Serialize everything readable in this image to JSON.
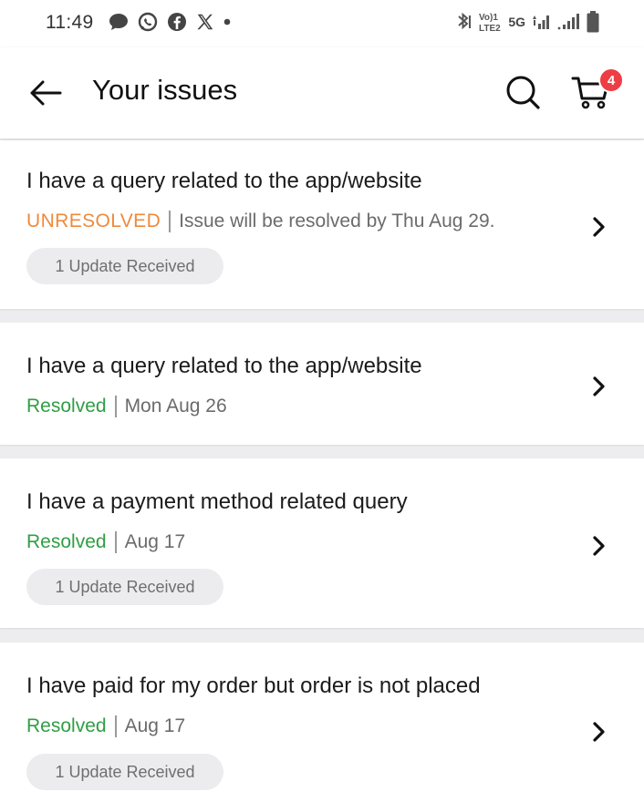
{
  "status_bar": {
    "time": "11:49",
    "notification_icons": [
      "message-icon",
      "whatsapp-icon",
      "facebook-icon",
      "x-icon",
      "dot-icon"
    ],
    "network_label": "5G",
    "volte_label": "VoLTE2",
    "system_icons": [
      "bluetooth-icon",
      "volte-icon",
      "signal-icon",
      "signal-icon",
      "battery-icon"
    ]
  },
  "header": {
    "title": "Your issues",
    "cart_count": "4"
  },
  "issues": [
    {
      "title": "I have a query related to the app/website",
      "status": "UNRESOLVED",
      "detail": "Issue will be resolved by Thu Aug 29.",
      "update": "1 Update Received"
    },
    {
      "title": "I have a query related to the app/website",
      "status": "Resolved",
      "detail": "Mon Aug 26"
    },
    {
      "title": "I have a payment method related query",
      "status": "Resolved",
      "detail": "Aug 17",
      "update": "1 Update Received"
    },
    {
      "title": "I have paid for my order but order is not placed",
      "status": "Resolved",
      "detail": "Aug 17",
      "update": "1 Update Received"
    }
  ],
  "colors": {
    "unresolved": "#ee8a3c",
    "resolved": "#2f9e44",
    "badge": "#ee3d45"
  }
}
